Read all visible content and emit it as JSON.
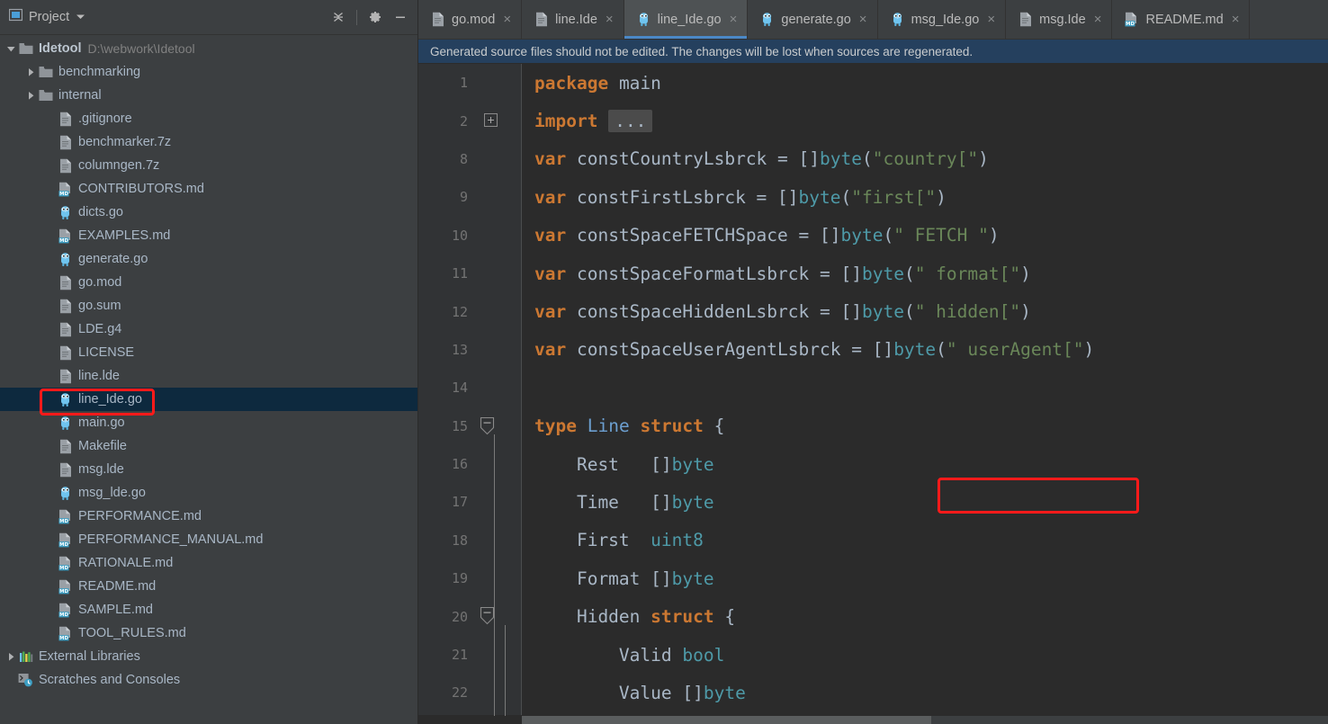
{
  "project_panel": {
    "title": "Project",
    "icons": {
      "panel": "project-panel-icon",
      "dropdown": "chevron-down-icon",
      "collapse_all": "collapse-all-icon",
      "settings": "gear-icon",
      "hide": "minimize-icon"
    },
    "tree": [
      {
        "label": "Idetool",
        "sub": "D:\\webwork\\Idetool",
        "icon": "folder-icon",
        "arrow": "expanded",
        "indent": 0,
        "bold": true,
        "selected": false
      },
      {
        "label": "benchmarking",
        "sub": "",
        "icon": "folder-icon",
        "arrow": "collapsed",
        "indent": 1,
        "bold": false,
        "selected": false
      },
      {
        "label": "internal",
        "sub": "",
        "icon": "folder-icon",
        "arrow": "collapsed",
        "indent": 1,
        "bold": false,
        "selected": false
      },
      {
        "label": ".gitignore",
        "sub": "",
        "icon": "file-icon",
        "arrow": "none",
        "indent": 2,
        "bold": false,
        "selected": false
      },
      {
        "label": "benchmarker.7z",
        "sub": "",
        "icon": "file-icon",
        "arrow": "none",
        "indent": 2,
        "bold": false,
        "selected": false
      },
      {
        "label": "columngen.7z",
        "sub": "",
        "icon": "file-icon",
        "arrow": "none",
        "indent": 2,
        "bold": false,
        "selected": false
      },
      {
        "label": "CONTRIBUTORS.md",
        "sub": "",
        "icon": "markdown-icon",
        "arrow": "none",
        "indent": 2,
        "bold": false,
        "selected": false
      },
      {
        "label": "dicts.go",
        "sub": "",
        "icon": "go-icon",
        "arrow": "none",
        "indent": 2,
        "bold": false,
        "selected": false
      },
      {
        "label": "EXAMPLES.md",
        "sub": "",
        "icon": "markdown-icon",
        "arrow": "none",
        "indent": 2,
        "bold": false,
        "selected": false
      },
      {
        "label": "generate.go",
        "sub": "",
        "icon": "go-icon",
        "arrow": "none",
        "indent": 2,
        "bold": false,
        "selected": false
      },
      {
        "label": "go.mod",
        "sub": "",
        "icon": "file-icon",
        "arrow": "none",
        "indent": 2,
        "bold": false,
        "selected": false
      },
      {
        "label": "go.sum",
        "sub": "",
        "icon": "file-icon",
        "arrow": "none",
        "indent": 2,
        "bold": false,
        "selected": false
      },
      {
        "label": "LDE.g4",
        "sub": "",
        "icon": "file-icon",
        "arrow": "none",
        "indent": 2,
        "bold": false,
        "selected": false
      },
      {
        "label": "LICENSE",
        "sub": "",
        "icon": "file-icon",
        "arrow": "none",
        "indent": 2,
        "bold": false,
        "selected": false
      },
      {
        "label": "line.lde",
        "sub": "",
        "icon": "file-icon",
        "arrow": "none",
        "indent": 2,
        "bold": false,
        "selected": false
      },
      {
        "label": "line_Ide.go",
        "sub": "",
        "icon": "go-icon",
        "arrow": "none",
        "indent": 2,
        "bold": false,
        "selected": true
      },
      {
        "label": "main.go",
        "sub": "",
        "icon": "go-icon",
        "arrow": "none",
        "indent": 2,
        "bold": false,
        "selected": false
      },
      {
        "label": "Makefile",
        "sub": "",
        "icon": "file-icon",
        "arrow": "none",
        "indent": 2,
        "bold": false,
        "selected": false
      },
      {
        "label": "msg.lde",
        "sub": "",
        "icon": "file-icon",
        "arrow": "none",
        "indent": 2,
        "bold": false,
        "selected": false
      },
      {
        "label": "msg_lde.go",
        "sub": "",
        "icon": "go-icon",
        "arrow": "none",
        "indent": 2,
        "bold": false,
        "selected": false
      },
      {
        "label": "PERFORMANCE.md",
        "sub": "",
        "icon": "markdown-icon",
        "arrow": "none",
        "indent": 2,
        "bold": false,
        "selected": false
      },
      {
        "label": "PERFORMANCE_MANUAL.md",
        "sub": "",
        "icon": "markdown-icon",
        "arrow": "none",
        "indent": 2,
        "bold": false,
        "selected": false
      },
      {
        "label": "RATIONALE.md",
        "sub": "",
        "icon": "markdown-icon",
        "arrow": "none",
        "indent": 2,
        "bold": false,
        "selected": false
      },
      {
        "label": "README.md",
        "sub": "",
        "icon": "markdown-icon",
        "arrow": "none",
        "indent": 2,
        "bold": false,
        "selected": false
      },
      {
        "label": "SAMPLE.md",
        "sub": "",
        "icon": "markdown-icon",
        "arrow": "none",
        "indent": 2,
        "bold": false,
        "selected": false
      },
      {
        "label": "TOOL_RULES.md",
        "sub": "",
        "icon": "markdown-icon",
        "arrow": "none",
        "indent": 2,
        "bold": false,
        "selected": false
      },
      {
        "label": "External Libraries",
        "sub": "",
        "icon": "libraries-icon",
        "arrow": "collapsed",
        "indent": 0,
        "bold": false,
        "selected": false
      },
      {
        "label": "Scratches and Consoles",
        "sub": "",
        "icon": "scratches-icon",
        "arrow": "none",
        "indent": 0,
        "bold": false,
        "selected": false
      }
    ]
  },
  "editor": {
    "tabs": [
      {
        "label": "go.mod",
        "icon": "file-icon",
        "active": false
      },
      {
        "label": "line.Ide",
        "icon": "file-icon",
        "active": false
      },
      {
        "label": "line_Ide.go",
        "icon": "go-icon",
        "active": true
      },
      {
        "label": "generate.go",
        "icon": "go-icon",
        "active": false
      },
      {
        "label": "msg_Ide.go",
        "icon": "go-icon",
        "active": false
      },
      {
        "label": "msg.Ide",
        "icon": "file-icon",
        "active": false
      },
      {
        "label": "README.md",
        "icon": "markdown-icon",
        "active": false
      }
    ],
    "tab_close_glyph": "×",
    "banner": {
      "text": "Generated source files should not be edited. The changes will be lost when sources are regenerated.",
      "background": "#25405e"
    },
    "lines": [
      {
        "num": "1",
        "fold": "none",
        "tokens": [
          {
            "t": "package",
            "c": "kw"
          },
          {
            "t": " ",
            "c": "pln"
          },
          {
            "t": "main",
            "c": "pln"
          }
        ]
      },
      {
        "num": "2",
        "fold": "collapsed",
        "tokens": [
          {
            "t": "import",
            "c": "kw"
          },
          {
            "t": " ",
            "c": "pln"
          },
          {
            "t": "...",
            "c": "fold"
          }
        ]
      },
      {
        "num": "8",
        "fold": "none",
        "tokens": [
          {
            "t": "var",
            "c": "kw"
          },
          {
            "t": " constCountryLsbrck = []",
            "c": "pln"
          },
          {
            "t": "byte",
            "c": "bi"
          },
          {
            "t": "(",
            "c": "pln"
          },
          {
            "t": "\"country[\"",
            "c": "str"
          },
          {
            "t": ")",
            "c": "pln"
          }
        ]
      },
      {
        "num": "9",
        "fold": "none",
        "tokens": [
          {
            "t": "var",
            "c": "kw"
          },
          {
            "t": " constFirstLsbrck = []",
            "c": "pln"
          },
          {
            "t": "byte",
            "c": "bi"
          },
          {
            "t": "(",
            "c": "pln"
          },
          {
            "t": "\"first[\"",
            "c": "str"
          },
          {
            "t": ")",
            "c": "pln"
          }
        ]
      },
      {
        "num": "10",
        "fold": "none",
        "tokens": [
          {
            "t": "var",
            "c": "kw"
          },
          {
            "t": " constSpaceFETCHSpace = []",
            "c": "pln"
          },
          {
            "t": "byte",
            "c": "bi"
          },
          {
            "t": "(",
            "c": "pln"
          },
          {
            "t": "\" FETCH \"",
            "c": "str"
          },
          {
            "t": ")",
            "c": "pln"
          }
        ]
      },
      {
        "num": "11",
        "fold": "none",
        "tokens": [
          {
            "t": "var",
            "c": "kw"
          },
          {
            "t": " constSpaceFormatLsbrck = []",
            "c": "pln"
          },
          {
            "t": "byte",
            "c": "bi"
          },
          {
            "t": "(",
            "c": "pln"
          },
          {
            "t": "\" format[\"",
            "c": "str"
          },
          {
            "t": ")",
            "c": "pln"
          }
        ]
      },
      {
        "num": "12",
        "fold": "none",
        "tokens": [
          {
            "t": "var",
            "c": "kw"
          },
          {
            "t": " constSpaceHiddenLsbrck = []",
            "c": "pln"
          },
          {
            "t": "byte",
            "c": "bi"
          },
          {
            "t": "(",
            "c": "pln"
          },
          {
            "t": "\" hidden[\"",
            "c": "str"
          },
          {
            "t": ")",
            "c": "pln"
          }
        ]
      },
      {
        "num": "13",
        "fold": "none",
        "tokens": [
          {
            "t": "var",
            "c": "kw"
          },
          {
            "t": " constSpaceUserAgentLsbrck = []",
            "c": "pln"
          },
          {
            "t": "byte",
            "c": "bi"
          },
          {
            "t": "(",
            "c": "pln"
          },
          {
            "t": "\" userAgent[\"",
            "c": "str"
          },
          {
            "t": ")",
            "c": "pln"
          }
        ]
      },
      {
        "num": "14",
        "fold": "none",
        "tokens": []
      },
      {
        "num": "15",
        "fold": "expanded",
        "tokens": [
          {
            "t": "type",
            "c": "kw"
          },
          {
            "t": " ",
            "c": "pln"
          },
          {
            "t": "Line",
            "c": "typ"
          },
          {
            "t": " ",
            "c": "pln"
          },
          {
            "t": "struct",
            "c": "kw"
          },
          {
            "t": " {",
            "c": "pln"
          }
        ]
      },
      {
        "num": "16",
        "fold": "none",
        "tokens": [
          {
            "t": "    Rest   []",
            "c": "pln"
          },
          {
            "t": "byte",
            "c": "bi"
          }
        ]
      },
      {
        "num": "17",
        "fold": "none",
        "tokens": [
          {
            "t": "    Time   []",
            "c": "pln"
          },
          {
            "t": "byte",
            "c": "bi"
          }
        ]
      },
      {
        "num": "18",
        "fold": "none",
        "tokens": [
          {
            "t": "    First  ",
            "c": "pln"
          },
          {
            "t": "uint8",
            "c": "bi"
          }
        ]
      },
      {
        "num": "19",
        "fold": "none",
        "tokens": [
          {
            "t": "    Format []",
            "c": "pln"
          },
          {
            "t": "byte",
            "c": "bi"
          }
        ]
      },
      {
        "num": "20",
        "fold": "expanded",
        "tokens": [
          {
            "t": "    Hidden ",
            "c": "pln"
          },
          {
            "t": "struct",
            "c": "kw"
          },
          {
            "t": " {",
            "c": "pln"
          }
        ]
      },
      {
        "num": "21",
        "fold": "none",
        "tokens": [
          {
            "t": "        Valid ",
            "c": "pln"
          },
          {
            "t": "bool",
            "c": "bi"
          }
        ]
      },
      {
        "num": "22",
        "fold": "none",
        "tokens": [
          {
            "t": "        Value []",
            "c": "pln"
          },
          {
            "t": "byte",
            "c": "bi"
          }
        ]
      }
    ]
  },
  "annotations": [
    {
      "name": "highlight-tree-file",
      "target": "line_Ide.go",
      "color": "#ff1a1a"
    },
    {
      "name": "highlight-struct-declaration",
      "target": "type Line struct",
      "color": "#ff1a1a"
    }
  ]
}
